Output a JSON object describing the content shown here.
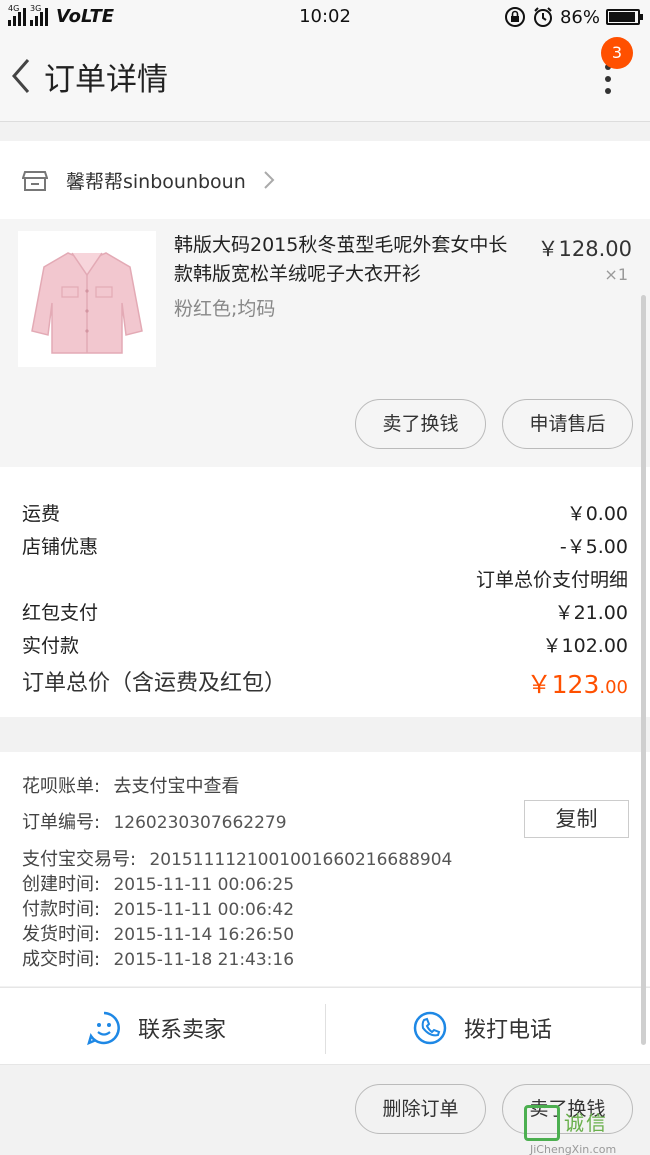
{
  "status_bar": {
    "net1": "4G",
    "net2": "3G",
    "volte": "VoLTE",
    "time": "10:02",
    "battery": "86%",
    "battery_level": 0.86
  },
  "nav": {
    "title": "订单详情",
    "badge": "3"
  },
  "shop": {
    "name": "馨帮帮sinbounboun"
  },
  "item": {
    "title": "韩版大码2015秋冬茧型毛呢外套女中长款韩版宽松羊绒呢子大衣开衫",
    "sku": "粉红色;均码",
    "price": "￥128.00",
    "qty": "×1",
    "btn_sell": "卖了换钱",
    "btn_after_sale": "申请售后"
  },
  "fees": {
    "shipping_label": "运费",
    "shipping_value": "￥0.00",
    "discount_label": "店铺优惠",
    "discount_value": "-￥5.00",
    "detail_link": "订单总价支付明细",
    "redpack_label": "红包支付",
    "redpack_value": "￥21.00",
    "paid_label": "实付款",
    "paid_value": "￥102.00",
    "total_label": "订单总价（含运费及红包）",
    "total_int": "￥123",
    "total_dec": ".00"
  },
  "info": {
    "huabei_label": "花呗账单:",
    "huabei_value": "去支付宝中查看",
    "order_no_label": "订单编号:",
    "order_no": "1260230307662279",
    "copy_btn": "复制",
    "alipay_label": "支付宝交易号:",
    "alipay_no": "2015111121001001660216688904",
    "created_label": "创建时间:",
    "created": "2015-11-11 00:06:25",
    "paid_label": "付款时间:",
    "paid": "2015-11-11 00:06:42",
    "shipped_label": "发货时间:",
    "shipped": "2015-11-14 16:26:50",
    "done_label": "成交时间:",
    "done": "2015-11-18 21:43:16"
  },
  "contact": {
    "seller": "联系卖家",
    "phone": "拨打电话"
  },
  "bottom": {
    "delete": "删除订单",
    "sell": "卖了换钱"
  },
  "watermark": {
    "text": "诚信",
    "url": "JiChengXin.com"
  },
  "colors": {
    "accent": "#ff5000",
    "link_blue": "#1e88e5"
  }
}
